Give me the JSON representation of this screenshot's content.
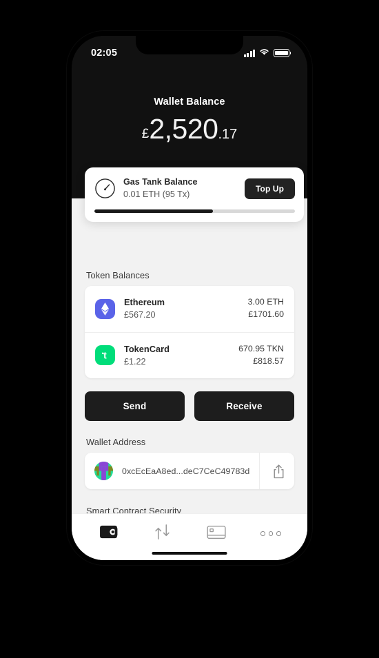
{
  "status_bar": {
    "time": "02:05",
    "signal_icon": "signal-bars-icon",
    "wifi_icon": "wifi-icon",
    "battery_icon": "battery-full-icon"
  },
  "header": {
    "title": "Wallet Balance",
    "currency_symbol": "£",
    "amount_main": "2,520",
    "amount_decimal": ".17"
  },
  "gas_tank": {
    "icon": "gas-gauge-icon",
    "title": "Gas Tank Balance",
    "subtitle": "0.01 ETH (95 Tx)",
    "button_label": "Top Up",
    "progress_percent": 59
  },
  "token_balances": {
    "section_label": "Token Balances",
    "tokens": [
      {
        "icon": "ethereum-icon",
        "icon_color": "#5a63e8",
        "name": "Ethereum",
        "fiat_price": "£567.20",
        "amount": "3.00 ETH",
        "value": "£1701.60"
      },
      {
        "icon": "tokencard-icon",
        "icon_color": "#00dd7a",
        "name": "TokenCard",
        "fiat_price": "£1.22",
        "amount": "670.95 TKN",
        "value": "£818.57"
      }
    ]
  },
  "actions": {
    "send_label": "Send",
    "receive_label": "Receive"
  },
  "wallet_address": {
    "section_label": "Wallet Address",
    "avatar": "identicon-avatar",
    "address": "0xcEcEaA8ed...deC7CeC49783d",
    "share_icon": "share-icon"
  },
  "smart_contract_security": {
    "section_label": "Smart Contract Security"
  },
  "tab_bar": {
    "tabs": [
      {
        "name": "wallet-tab",
        "icon": "wallet-icon",
        "active": true
      },
      {
        "name": "transfer-tab",
        "icon": "transfer-arrows-icon",
        "active": false
      },
      {
        "name": "card-tab",
        "icon": "card-icon",
        "active": false
      },
      {
        "name": "more-tab",
        "icon": "more-dots-icon",
        "active": false
      }
    ]
  },
  "theme": {
    "header_bg": "#111111",
    "body_bg": "#f2f2f2",
    "accent_dark": "#1d1d1d"
  }
}
